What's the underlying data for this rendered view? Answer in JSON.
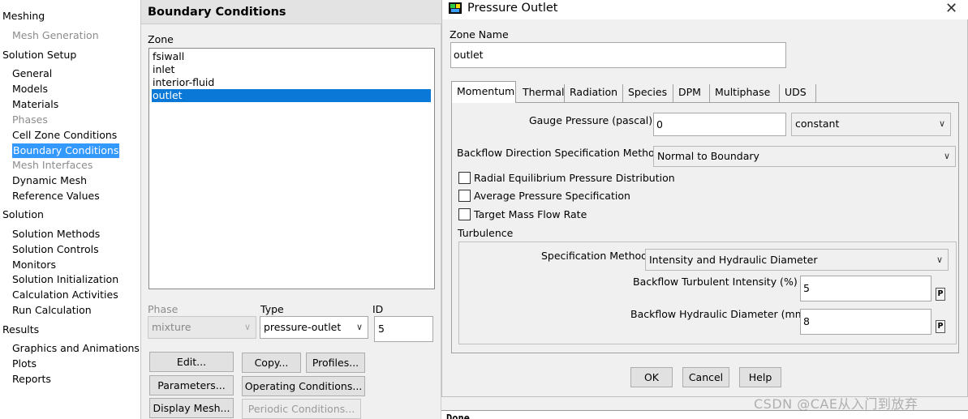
{
  "tree": {
    "meshing": "Meshing",
    "mesh_generation": "Mesh Generation",
    "solution_setup": "Solution Setup",
    "general": "General",
    "models": "Models",
    "materials": "Materials",
    "phases": "Phases",
    "cell_zone_conditions": "Cell Zone Conditions",
    "boundary_conditions": "Boundary Conditions",
    "mesh_interfaces": "Mesh Interfaces",
    "dynamic_mesh": "Dynamic Mesh",
    "reference_values": "Reference Values",
    "solution": "Solution",
    "solution_methods": "Solution Methods",
    "solution_controls": "Solution Controls",
    "monitors": "Monitors",
    "solution_initialization": "Solution Initialization",
    "calculation_activities": "Calculation Activities",
    "run_calculation": "Run Calculation",
    "results": "Results",
    "graphics_and_animations": "Graphics and Animations",
    "plots": "Plots",
    "reports": "Reports"
  },
  "bc_panel": {
    "title": "Boundary Conditions",
    "zone_label": "Zone",
    "zones": [
      "fsiwall",
      "inlet",
      "interior-fluid",
      "outlet"
    ],
    "selected_zone": "outlet",
    "phase_label": "Phase",
    "phase_value": "mixture",
    "type_label": "Type",
    "type_value": "pressure-outlet",
    "id_label": "ID",
    "id_value": "5",
    "buttons": {
      "edit": "Edit...",
      "copy": "Copy...",
      "profiles": "Profiles...",
      "parameters": "Parameters...",
      "operating_conditions": "Operating Conditions...",
      "display_mesh": "Display Mesh...",
      "periodic_conditions": "Periodic Conditions..."
    }
  },
  "dialog": {
    "title": "Pressure Outlet",
    "zone_name_label": "Zone Name",
    "zone_name_value": "outlet",
    "tabs": [
      "Momentum",
      "Thermal",
      "Radiation",
      "Species",
      "DPM",
      "Multiphase",
      "UDS"
    ],
    "active_tab": "Momentum",
    "gauge_pressure_label": "Gauge Pressure (pascal)",
    "gauge_pressure_value": "0",
    "gauge_pressure_method": "constant",
    "backflow_direction_label": "Backflow Direction Specification Method",
    "backflow_direction_value": "Normal to Boundary",
    "checkboxes": {
      "radial_equilibrium": "Radial Equilibrium Pressure Distribution",
      "average_pressure": "Average Pressure Specification",
      "target_mass_flow": "Target Mass Flow Rate"
    },
    "turbulence_label": "Turbulence",
    "spec_method_label": "Specification Method",
    "spec_method_value": "Intensity and Hydraulic Diameter",
    "turb_intensity_label": "Backflow Turbulent Intensity (%)",
    "turb_intensity_value": "5",
    "hydraulic_diameter_label": "Backflow Hydraulic Diameter (mm)",
    "hydraulic_diameter_value": "8",
    "p_label": "P",
    "ok": "OK",
    "cancel": "Cancel",
    "help": "Help"
  },
  "console_text": "Done.",
  "watermark": "CSDN @CAE从入门到放弃"
}
